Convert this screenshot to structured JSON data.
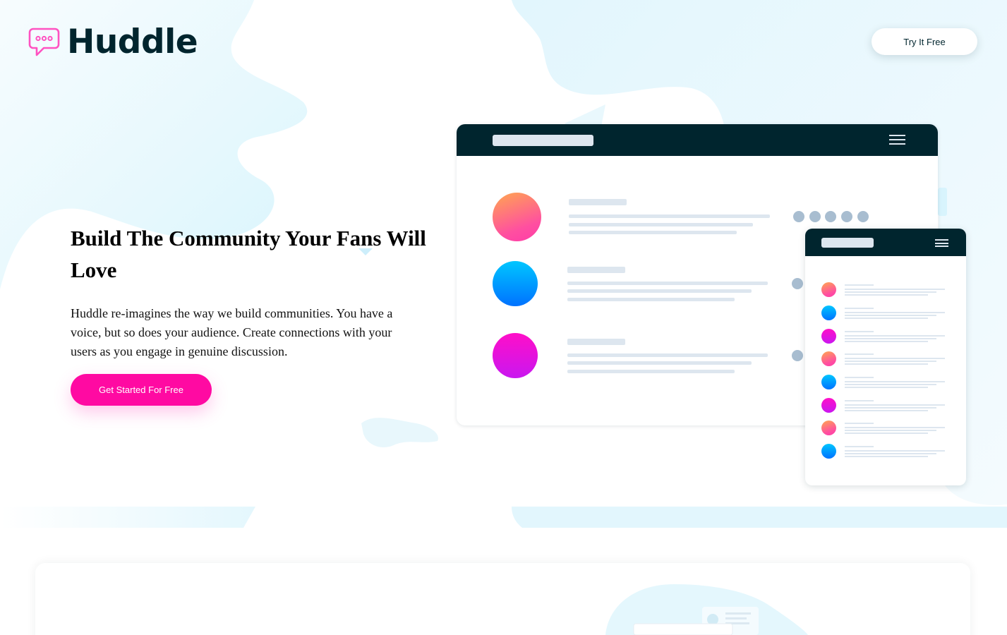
{
  "brand": {
    "name": "Huddle",
    "accent": "#ff0aa2",
    "dark": "#00252e"
  },
  "header": {
    "try_label": "Try It Free"
  },
  "hero": {
    "title": "Build The Community Your Fans Will Love",
    "description": "Huddle re-imagines the way we build communities. You have a voice, but so does your audience. Create connections with your users as you engage in genuine discussion.",
    "cta_label": "Get Started For Free"
  },
  "icons": {
    "logo": "chat-bubble-icon",
    "menu": "hamburger-menu-icon"
  }
}
